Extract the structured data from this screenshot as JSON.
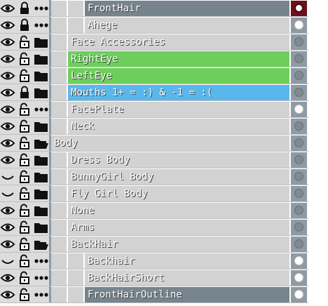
{
  "layers": [
    {
      "label": "FrontHair",
      "visible": true,
      "locked": true,
      "type": "dots",
      "indent": 2,
      "color": "#76848e",
      "indicator": "selected",
      "selected": true
    },
    {
      "label": "Ahege",
      "visible": true,
      "locked": true,
      "type": "dots",
      "indent": 2,
      "color": "#d2d2d2",
      "indicator": "on"
    },
    {
      "label": "Face Accessories",
      "visible": true,
      "locked": false,
      "type": "folder",
      "indent": 1,
      "color": "#d2d2d2",
      "indicator": "off"
    },
    {
      "label": "RightEye",
      "visible": true,
      "locked": false,
      "type": "folder",
      "indent": 1,
      "color": "#6dcf5a",
      "indicator": "off"
    },
    {
      "label": "LeftEye",
      "visible": true,
      "locked": false,
      "type": "folder",
      "indent": 1,
      "color": "#6dcf5a",
      "indicator": "off"
    },
    {
      "label": "Mouths 1+ = :) & -1 = :(",
      "visible": true,
      "locked": true,
      "type": "folder",
      "indent": 1,
      "color": "#5ab7ec",
      "indicator": "off"
    },
    {
      "label": "FacePlate",
      "visible": true,
      "locked": false,
      "type": "dots",
      "indent": 1,
      "color": "#d2d2d2",
      "indicator": "on"
    },
    {
      "label": "Neck",
      "visible": true,
      "locked": false,
      "type": "folder",
      "indent": 1,
      "color": "#d2d2d2",
      "indicator": "off"
    },
    {
      "label": "Body",
      "visible": true,
      "locked": false,
      "type": "folder-open",
      "indent": 0,
      "color": "#d2d2d2",
      "indicator": "off"
    },
    {
      "label": "Dress Body",
      "visible": true,
      "locked": false,
      "type": "folder",
      "indent": 1,
      "color": "#d2d2d2",
      "indicator": "off"
    },
    {
      "label": "BunnyGirl Body",
      "visible": false,
      "locked": false,
      "type": "folder",
      "indent": 1,
      "color": "#d2d2d2",
      "indicator": "off"
    },
    {
      "label": "Fly Girl Body",
      "visible": false,
      "locked": false,
      "type": "folder",
      "indent": 1,
      "color": "#d2d2d2",
      "indicator": "off"
    },
    {
      "label": "None",
      "visible": true,
      "locked": false,
      "type": "folder",
      "indent": 1,
      "color": "#d2d2d2",
      "indicator": "off"
    },
    {
      "label": "Arms",
      "visible": true,
      "locked": false,
      "type": "folder",
      "indent": 1,
      "color": "#d2d2d2",
      "indicator": "off"
    },
    {
      "label": "BackHair",
      "visible": true,
      "locked": false,
      "type": "folder-open",
      "indent": 1,
      "color": "#d2d2d2",
      "indicator": "off"
    },
    {
      "label": "Backhair",
      "visible": false,
      "locked": false,
      "type": "dots",
      "indent": 2,
      "color": "#d2d2d2",
      "indicator": "on"
    },
    {
      "label": "BackHairShort",
      "visible": true,
      "locked": false,
      "type": "dots",
      "indent": 2,
      "color": "#d2d2d2",
      "indicator": "on"
    },
    {
      "label": "FrontHairOutline",
      "visible": true,
      "locked": false,
      "type": "dots",
      "indent": 2,
      "color": "#76848e",
      "indicator": "on"
    }
  ]
}
